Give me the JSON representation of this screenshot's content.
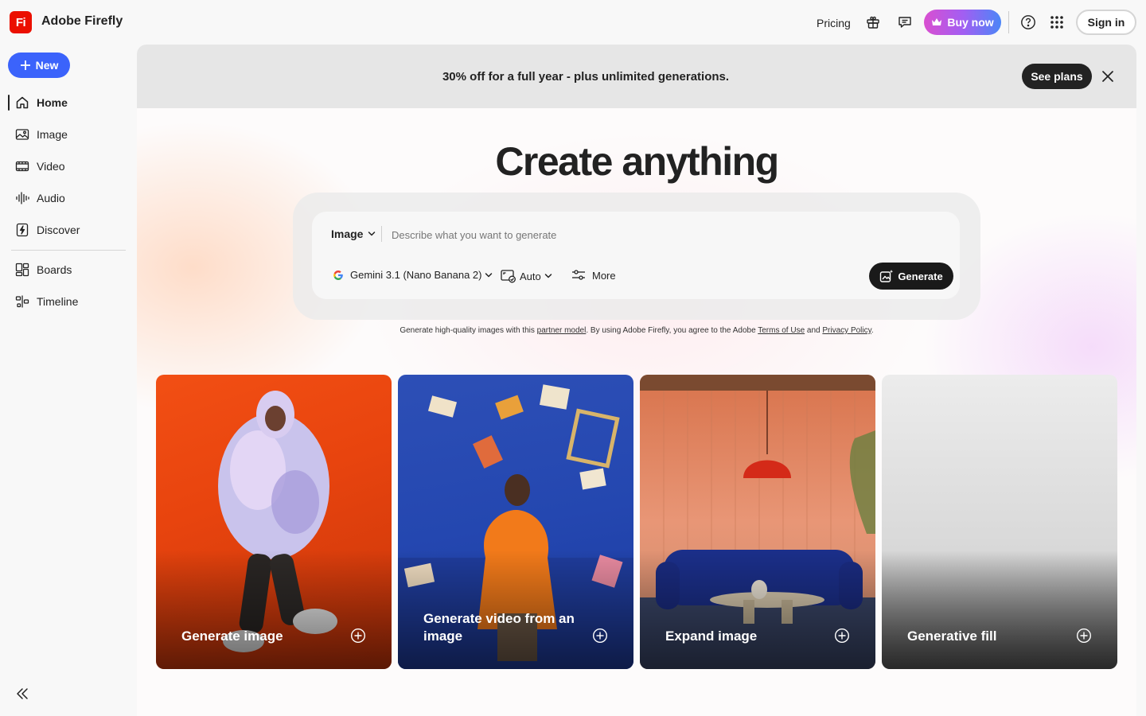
{
  "app": {
    "logo_text": "Fi",
    "name": "Adobe Firefly"
  },
  "header": {
    "pricing": "Pricing",
    "buy_now": "Buy now",
    "sign_in": "Sign in"
  },
  "sidebar": {
    "new_label": "New",
    "items": [
      {
        "label": "Home",
        "icon": "home-icon",
        "active": true
      },
      {
        "label": "Image",
        "icon": "image-icon"
      },
      {
        "label": "Video",
        "icon": "video-icon"
      },
      {
        "label": "Audio",
        "icon": "audio-icon"
      },
      {
        "label": "Discover",
        "icon": "discover-icon"
      },
      {
        "label": "Boards",
        "icon": "boards-icon"
      },
      {
        "label": "Timeline",
        "icon": "timeline-icon"
      }
    ]
  },
  "promo": {
    "text": "30% off for a full year - plus unlimited generations.",
    "see_plans": "See plans"
  },
  "hero": {
    "headline": "Create anything"
  },
  "prompt": {
    "type": "Image",
    "placeholder": "Describe what you want to generate",
    "model": "Gemini 3.1 (Nano Banana 2)",
    "aspect": "Auto",
    "more": "More",
    "generate": "Generate"
  },
  "disclaimer": {
    "part1": "Generate high-quality images with this ",
    "partner_model": "partner model",
    "part2": ". By using Adobe Firefly, you agree to the Adobe ",
    "terms": "Terms of Use",
    "part3": " and ",
    "privacy": "Privacy Policy",
    "part4": "."
  },
  "cards": [
    {
      "label": "Generate image"
    },
    {
      "label": "Generate video from an image"
    },
    {
      "label": "Expand image"
    },
    {
      "label": "Generative fill"
    }
  ],
  "colors": {
    "accent_blue": "#3b63fb",
    "logo_red": "#eb1000",
    "dark": "#1a1a1a"
  }
}
